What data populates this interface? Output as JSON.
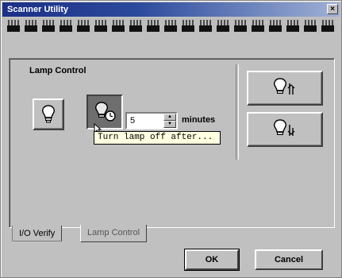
{
  "window": {
    "title": "Scanner Utility",
    "close_glyph": "×"
  },
  "lamp_control": {
    "label": "Lamp Control",
    "minutes_value": "5",
    "minutes_label": "minutes",
    "tooltip": "Turn lamp off after...",
    "icons": {
      "lamp_on": "lightbulb-icon",
      "lamp_timer": "lightbulb-timer-icon",
      "lamp_test_1": "lightbulb-test-1-icon",
      "lamp_test_2": "lightbulb-test-2-icon"
    }
  },
  "tabs": [
    {
      "label": "I/O Verify",
      "selected": false
    },
    {
      "label": "Lamp Control",
      "selected": true
    }
  ],
  "buttons": {
    "ok": "OK",
    "cancel": "Cancel"
  }
}
